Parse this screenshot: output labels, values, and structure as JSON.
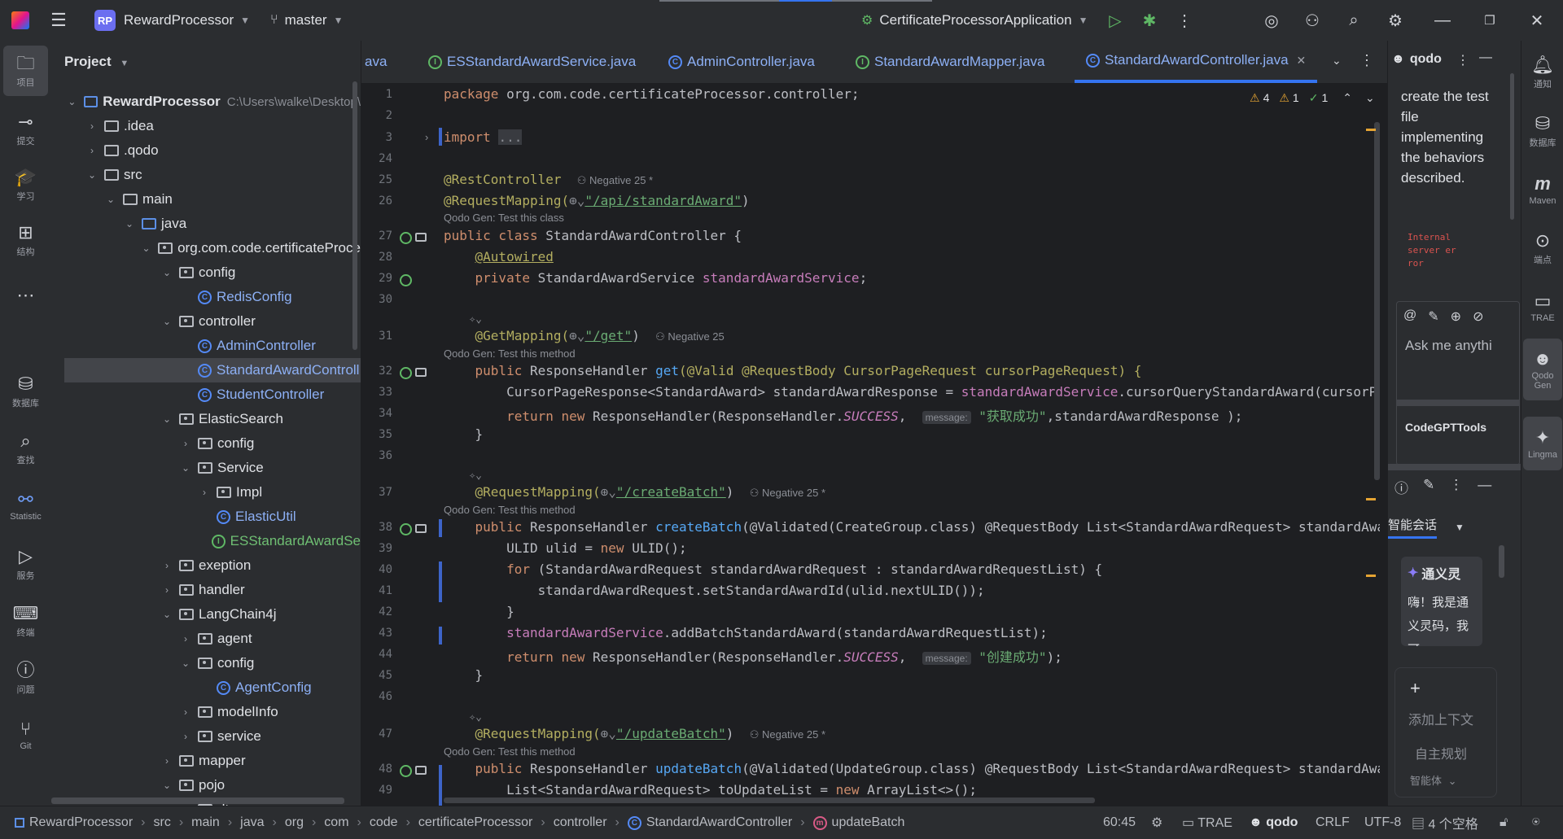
{
  "titlebar": {
    "project_badge": "RP",
    "project_name": "RewardProcessor",
    "branch": "master",
    "run_config": "CertificateProcessorApplication"
  },
  "left_strip": [
    {
      "label": "项目",
      "icon": "folder-icon"
    },
    {
      "label": "提交",
      "icon": "commit-icon"
    },
    {
      "label": "学习",
      "icon": "learn-icon"
    },
    {
      "label": "结构",
      "icon": "structure-icon"
    },
    {
      "label": "",
      "icon": "more-icon"
    },
    {
      "label": "数据库",
      "icon": "database-icon"
    },
    {
      "label": "查找",
      "icon": "search-icon"
    },
    {
      "label": "Statistic",
      "icon": "statistic-icon"
    },
    {
      "label": "服务",
      "icon": "services-icon"
    },
    {
      "label": "终端",
      "icon": "terminal-icon"
    },
    {
      "label": "问题",
      "icon": "problems-icon"
    },
    {
      "label": "Git",
      "icon": "git-icon"
    }
  ],
  "project": {
    "header": "Project",
    "tree": [
      {
        "depth": 0,
        "arrow": "v",
        "icon": "module",
        "name": "RewardProcessor",
        "extra": "C:\\Users\\walke\\Desktop\\"
      },
      {
        "depth": 1,
        "arrow": ">",
        "icon": "folder",
        "name": ".idea"
      },
      {
        "depth": 1,
        "arrow": ">",
        "icon": "folder",
        "name": ".qodo"
      },
      {
        "depth": 1,
        "arrow": "v",
        "icon": "folder",
        "name": "src"
      },
      {
        "depth": 2,
        "arrow": "v",
        "icon": "folder",
        "name": "main"
      },
      {
        "depth": 3,
        "arrow": "v",
        "icon": "src",
        "name": "java"
      },
      {
        "depth": 4,
        "arrow": "v",
        "icon": "pkg",
        "name": "org.com.code.certificateProce"
      },
      {
        "depth": 5,
        "arrow": "v",
        "icon": "pkg",
        "name": "config"
      },
      {
        "depth": 6,
        "arrow": "",
        "icon": "class",
        "name": "RedisConfig"
      },
      {
        "depth": 5,
        "arrow": "v",
        "icon": "pkg",
        "name": "controller"
      },
      {
        "depth": 6,
        "arrow": "",
        "icon": "class",
        "name": "AdminController"
      },
      {
        "depth": 6,
        "arrow": "",
        "icon": "class",
        "name": "StandardAwardControll",
        "selected": true
      },
      {
        "depth": 6,
        "arrow": "",
        "icon": "class",
        "name": "StudentController"
      },
      {
        "depth": 5,
        "arrow": "v",
        "icon": "pkg",
        "name": "ElasticSearch"
      },
      {
        "depth": 6,
        "arrow": ">",
        "icon": "pkg",
        "name": "config"
      },
      {
        "depth": 6,
        "arrow": "v",
        "icon": "pkg",
        "name": "Service"
      },
      {
        "depth": 7,
        "arrow": ">",
        "icon": "pkg",
        "name": "Impl"
      },
      {
        "depth": 7,
        "arrow": "",
        "icon": "class",
        "name": "ElasticUtil"
      },
      {
        "depth": 7,
        "arrow": "",
        "icon": "interface",
        "name": "ESStandardAwardSe"
      },
      {
        "depth": 5,
        "arrow": ">",
        "icon": "pkg",
        "name": "exeption"
      },
      {
        "depth": 5,
        "arrow": ">",
        "icon": "pkg",
        "name": "handler"
      },
      {
        "depth": 5,
        "arrow": "v",
        "icon": "pkg",
        "name": "LangChain4j"
      },
      {
        "depth": 6,
        "arrow": ">",
        "icon": "pkg",
        "name": "agent"
      },
      {
        "depth": 6,
        "arrow": "v",
        "icon": "pkg",
        "name": "config"
      },
      {
        "depth": 7,
        "arrow": "",
        "icon": "class",
        "name": "AgentConfig"
      },
      {
        "depth": 6,
        "arrow": ">",
        "icon": "pkg",
        "name": "modelInfo"
      },
      {
        "depth": 6,
        "arrow": ">",
        "icon": "pkg",
        "name": "service"
      },
      {
        "depth": 5,
        "arrow": ">",
        "icon": "pkg",
        "name": "mapper"
      },
      {
        "depth": 5,
        "arrow": "v",
        "icon": "pkg",
        "name": "pojo"
      },
      {
        "depth": 6,
        "arrow": ">",
        "icon": "pkg",
        "name": "dto"
      }
    ]
  },
  "tabs": [
    {
      "label": "ava",
      "icon": ""
    },
    {
      "label": "ESStandardAwardService.java",
      "icon": "interface"
    },
    {
      "label": "AdminController.java",
      "icon": "class"
    },
    {
      "label": "StandardAwardMapper.java",
      "icon": "interface"
    },
    {
      "label": "StandardAwardController.java",
      "icon": "class",
      "active": true
    }
  ],
  "inspections": {
    "warnings": "4",
    "weak_warnings": "1",
    "ok": "1"
  },
  "code": {
    "line_numbers": [
      "1",
      "2",
      "3",
      "24",
      "25",
      "26",
      "27",
      "28",
      "29",
      "30",
      "31",
      "32",
      "33",
      "34",
      "35",
      "36",
      "37",
      "38",
      "39",
      "40",
      "41",
      "42",
      "43",
      "44",
      "45",
      "46",
      "47",
      "48",
      "49"
    ],
    "package_kw": "package",
    "package_name": "org.com.code.certificateProcessor.controller;",
    "import_kw": "import",
    "import_fold": "...",
    "rest_controller": "@RestController",
    "usage_class": "Negative 25 *",
    "request_mapping": "@RequestMapping(",
    "path_standard": "\"/api/standardAward\"",
    "hint_test_class": "Qodo Gen: Test this class",
    "class_decl_kw": "public class",
    "class_name": "StandardAwardController {",
    "autowired": "@Autowired",
    "private_kw": "private",
    "service_type": "StandardAwardService",
    "service_field": "standardAwardService",
    "get_mapping": "@GetMapping(",
    "path_get": "\"/get\"",
    "usage_get": "Negative 25",
    "hint_test_method": "Qodo Gen: Test this method",
    "public_kw": "public",
    "rh_type": "ResponseHandler",
    "m_get": "get",
    "get_params": "(@Valid @RequestBody CursorPageRequest cursorPageRequest) {",
    "cursor_type": "CursorPageResponse<StandardAward> standardAwardResponse = ",
    "cursor_call": ".cursorQueryStandardAward(cursorPageRequest);",
    "return_kw": "return new",
    "rh_success": "ResponseHandler(ResponseHandler.",
    "success": "SUCCESS",
    "message_inlay": "message:",
    "msg_get": "\"获取成功\"",
    "get_tail": ",standardAwardResponse );",
    "close_brace": "}",
    "req_mapping": "@RequestMapping(",
    "path_create": "\"/createBatch\"",
    "usage_create": "Negative 25 *",
    "m_create": "createBatch",
    "create_params": "(@Validated(CreateGroup.class) @RequestBody List<StandardAwardRequest> standardAwardRequestList) {",
    "ulid_line": "ULID ulid = ",
    "ulid_new": "new",
    "ulid_tail": " ULID();",
    "for_kw": "for",
    "for_tail": " (StandardAwardRequest standardAwardRequest : standardAwardRequestList) {",
    "set_line": "standardAwardRequest.setStandardAwardId(ulid.nextULID());",
    "add_batch": ".addBatchStandardAward(standardAwardRequestList);",
    "msg_create": "\"创建成功\"",
    "create_tail": ");",
    "path_update": "\"/updateBatch\"",
    "usage_update": "Negative 25 *",
    "m_update": "updateBatch",
    "update_params": "(@Validated(UpdateGroup.class) @RequestBody List<StandardAwardRequest> standardAwardRequestList) {",
    "update_list": "List<StandardAwardRequest> toUpdateList = ",
    "update_list_tail": " ArrayList<>();"
  },
  "qodo_panel": {
    "header": "qodo",
    "message": "create the test file implementing the behaviors described.",
    "error_text": "Internal server error",
    "ask_placeholder": "Ask me anythi",
    "code_tools": "CodeGPTTools"
  },
  "tongyi_panel": {
    "tab": "智能会话",
    "brand": "通义灵",
    "greeting": "嗨！我是通义灵码，我可",
    "add_context": "添加上下文",
    "auto_plan": "自主规划",
    "agent": "智能体"
  },
  "right_strip": [
    {
      "label": "通知",
      "icon": "bell-icon"
    },
    {
      "label": "数据库",
      "icon": "database-icon"
    },
    {
      "label": "Maven",
      "icon": "maven-icon"
    },
    {
      "label": "端点",
      "icon": "endpoints-icon"
    },
    {
      "label": "TRAE",
      "icon": "trae-icon"
    },
    {
      "label": "Qodo Gen",
      "icon": "qodo-icon"
    },
    {
      "label": "Lingma",
      "icon": "lingma-icon"
    }
  ],
  "statusbar": {
    "breadcrumb": [
      "RewardProcessor",
      "src",
      "main",
      "java",
      "org",
      "com",
      "code",
      "certificateProcessor",
      "controller",
      "StandardAwardController",
      "updateBatch"
    ],
    "position": "60:45",
    "trae": "TRAE",
    "qodo": "qodo",
    "line_sep": "CRLF",
    "encoding": "UTF-8",
    "indent": "4 个空格"
  }
}
